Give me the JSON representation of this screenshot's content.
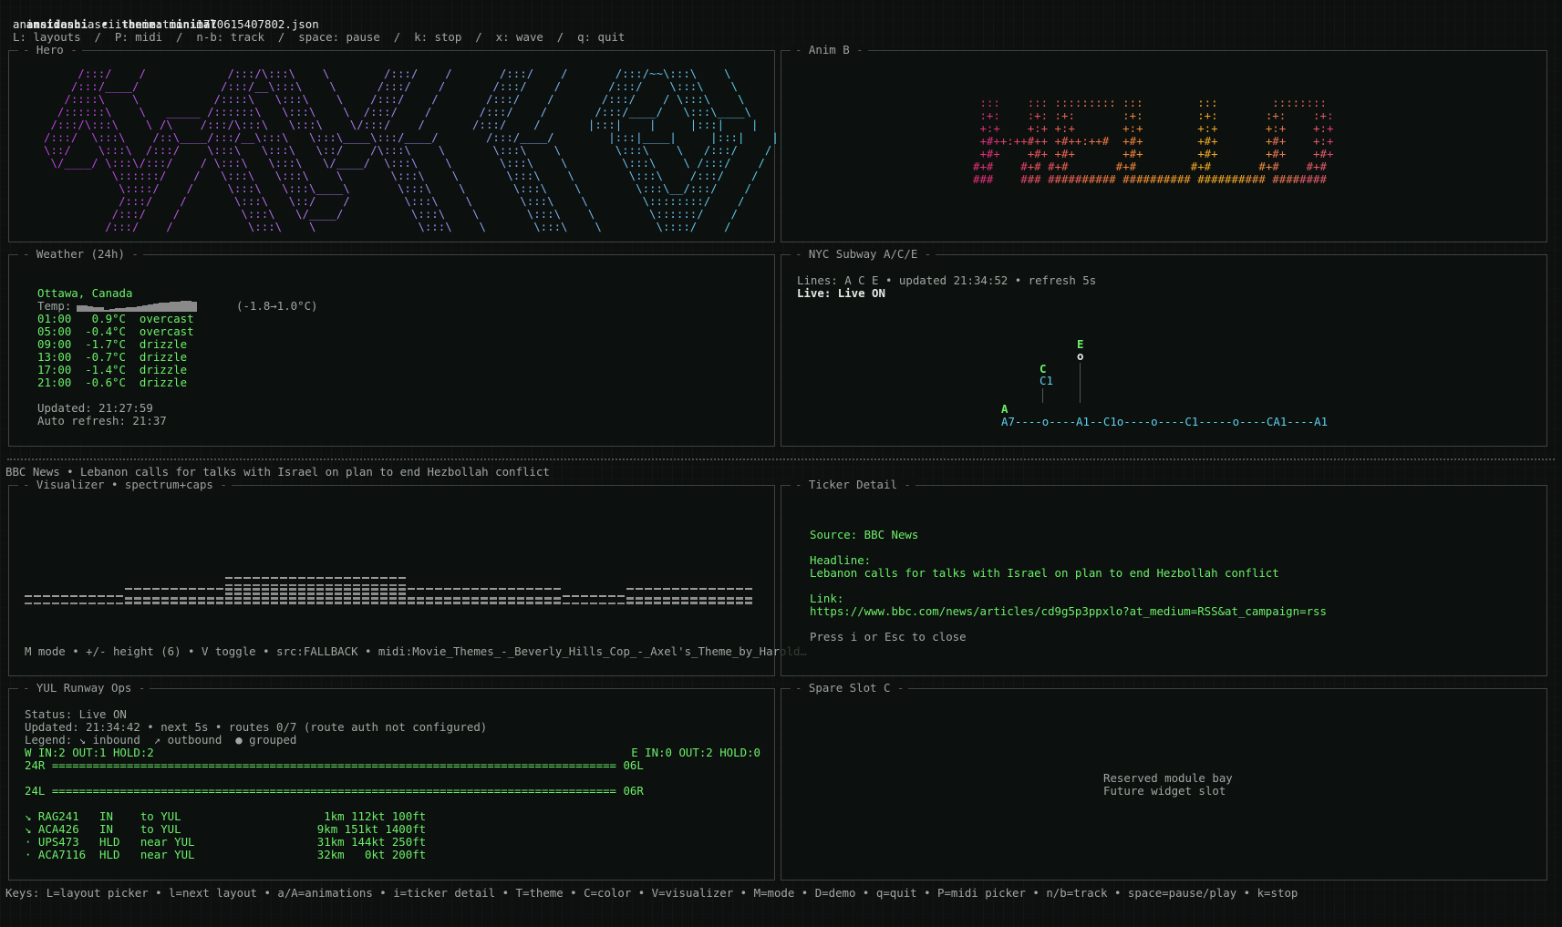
{
  "header": {
    "app_name": "ansidashi",
    "separator": "•",
    "theme_label": "theme: minimal",
    "animation_line": "animation: ascii-animation-1770615407802.json",
    "shortcuts_line": "L: layouts  /  P: midi  /  n-b: track  /  space: pause  /  k: stop  /  x: wave  /  q: quit"
  },
  "hero": {
    "title": "Hero",
    "art": "     /:::/    /            /:::/\\:::\\    \\        /:::/    /       /:::/    /       /:::/~~\\:::\\    \\\n    /:::/____/            /:::/__\\:::\\    \\      /:::/    /       /:::/    /       /:::/    \\:::\\    \\\n   /::::\\    \\           /::::\\   \\:::\\    \\    /:::/    /       /:::/    /       /:::/    / \\:::\\    \\\n  /::::::\\    \\   _____ /::::::\\   \\:::\\    \\  /:::/    /       /:::/    /       /:::/____/   \\:::\\____\\\n /:::/\\:::\\    \\ /\\    /:::/\\:::\\   \\:::\\    \\/:::/    /       /:::/    /       |:::|    |     |:::|    |\n/:::/  \\:::\\    /::\\____/:::/__\\:::\\   \\:::\\____\\:::/____/       /:::/____/        |:::|____|     |:::|    |\n\\::/    \\:::\\  /:::/    \\:::\\   \\:::\\   \\::/    /\\:::\\    \\       \\:::\\    \\        \\:::\\    \\   /:::/    /\n \\/____/ \\:::\\/:::/    / \\:::\\   \\:::\\   \\/____/  \\:::\\    \\       \\:::\\    \\        \\:::\\    \\ /:::/    /\n          \\::::::/    /   \\:::\\   \\:::\\    \\       \\:::\\    \\       \\:::\\    \\        \\:::\\    /:::/    /\n           \\::::/    /     \\:::\\   \\:::\\____\\       \\:::\\    \\       \\:::\\    \\        \\:::\\__/:::/    /\n           /:::/    /       \\:::\\   \\::/    /        \\:::\\    \\       \\:::\\    \\        \\::::::::/    /\n          /:::/    /         \\:::\\   \\/____/          \\:::\\    \\       \\:::\\    \\        \\::::::/    /\n         /:::/    /           \\:::\\    \\               \\:::\\    \\       \\:::\\    \\        \\::::/    /"
  },
  "anim_b": {
    "title": "Anim B",
    "art": " :::    ::: ::::::::: :::        :::        ::::::::\n :+:    :+: :+:       :+:        :+:       :+:    :+:\n +:+    +:+ +:+       +:+        +:+       +:+    +:+\n +#++:++#++ +#++:++#  +#+        +#+       +#+    +:+\n +#+    +#+ +#+       +#+        +#+       +#+    +#+\n#+#    #+# #+#       #+#        #+#       #+#    #+#\n###    ### ########## ########## ########## ########"
  },
  "weather": {
    "title": "Weather (24h)",
    "location": "Ottawa, Canada",
    "temp_label": "Temp:",
    "temp_range": "(-1.8→1.0°C)",
    "sparkline": [
      0.55,
      0.6,
      0.5,
      0.45,
      0.4,
      0.2,
      0.25,
      0.3,
      0.35,
      0.4,
      0.45,
      0.5,
      0.6,
      0.7,
      0.75,
      0.8,
      0.85,
      0.9,
      0.95,
      1.0,
      1.0,
      0.95
    ],
    "rows": [
      {
        "time": "01:00",
        "temp": "0.9°C",
        "cond": "overcast"
      },
      {
        "time": "05:00",
        "temp": "-0.4°C",
        "cond": "overcast"
      },
      {
        "time": "09:00",
        "temp": "-1.7°C",
        "cond": "drizzle"
      },
      {
        "time": "13:00",
        "temp": "-0.7°C",
        "cond": "drizzle"
      },
      {
        "time": "17:00",
        "temp": "-1.4°C",
        "cond": "drizzle"
      },
      {
        "time": "21:00",
        "temp": "-0.6°C",
        "cond": "drizzle"
      }
    ],
    "updated": "Updated: 21:27:59",
    "auto_refresh": "Auto refresh: 21:37"
  },
  "subway": {
    "title": "NYC Subway A/C/E",
    "status_line": "Lines: A C E • updated 21:34:52 • refresh 5s",
    "live_line": "Live: Live ON",
    "label_E": "E",
    "label_E_node": "o",
    "label_C": "C",
    "label_C1": "C1",
    "label_A": "A",
    "track": "A7----o----A1--C1o----o----C1-----o----CA1----A1"
  },
  "news_bar": "BBC News • Lebanon calls for talks with Israel on plan to end Hezbollah conflict",
  "visualizer": {
    "title": "Visualizer • spectrum+caps",
    "levels": [
      0.05,
      0.05,
      0.05,
      0.05,
      0.05,
      0.05,
      0.05,
      0.05,
      0.05,
      0.05,
      0.05,
      0.25,
      0.25,
      0.25,
      0.25,
      0.25,
      0.25,
      0.25,
      0.25,
      0.25,
      0.25,
      0.25,
      0.55,
      0.55,
      0.55,
      0.55,
      0.55,
      0.55,
      0.55,
      0.55,
      0.55,
      0.55,
      0.55,
      0.55,
      0.55,
      0.55,
      0.55,
      0.55,
      0.55,
      0.55,
      0.55,
      0.55,
      0.25,
      0.25,
      0.25,
      0.25,
      0.25,
      0.25,
      0.25,
      0.25,
      0.25,
      0.25,
      0.25,
      0.25,
      0.25,
      0.25,
      0.25,
      0.25,
      0.25,
      0.05,
      0.05,
      0.05,
      0.05,
      0.05,
      0.05,
      0.05,
      0.25,
      0.25,
      0.25,
      0.25,
      0.25,
      0.25,
      0.25,
      0.25,
      0.25,
      0.25,
      0.25,
      0.25,
      0.25,
      0.25
    ],
    "caps": [
      0.05,
      0.05,
      0.05,
      0.05,
      0.05,
      0.05,
      0.05,
      0.05,
      0.05,
      0.05,
      0.05,
      0.25,
      0.25,
      0.25,
      0.25,
      0.25,
      0.25,
      0.25,
      0.25,
      0.25,
      0.25,
      0.25,
      0.55,
      0.55,
      0.55,
      0.55,
      0.55,
      0.55,
      0.55,
      0.55,
      0.55,
      0.55,
      0.55,
      0.55,
      0.55,
      0.55,
      0.55,
      0.55,
      0.55,
      0.55,
      0.55,
      0.55,
      0.25,
      0.25,
      0.25,
      0.25,
      0.25,
      0.25,
      0.25,
      0.25,
      0.25,
      0.25,
      0.25,
      0.25,
      0.25,
      0.25,
      0.25,
      0.25,
      0.25,
      0.05,
      0.05,
      0.05,
      0.05,
      0.05,
      0.05,
      0.05,
      0.25,
      0.25,
      0.25,
      0.25,
      0.25,
      0.25,
      0.25,
      0.25,
      0.25,
      0.25,
      0.25,
      0.25,
      0.25,
      0.25
    ],
    "footer": "M mode • +/- height (6) • V toggle • src:FALLBACK • midi:Movie_Themes_-_Beverly_Hills_Cop_-_Axel's_Theme_by_Harold…"
  },
  "ticker": {
    "title": "Ticker Detail",
    "source": "Source: BBC News",
    "headline_label": "Headline:",
    "headline": "Lebanon calls for talks with Israel on plan to end Hezbollah conflict",
    "link_label": "Link:",
    "link": "https://www.bbc.com/news/articles/cd9g5p3ppxlo?at_medium=RSS&at_campaign=rss",
    "close_hint": "Press i or Esc to close"
  },
  "runway": {
    "title": "YUL Runway Ops",
    "status": "Status: Live ON",
    "updated": "Updated: 21:34:42 • next 5s • routes 0/7 (route auth not configured)",
    "legend": "Legend: ↘ inbound  ↗ outbound  ● grouped",
    "west": "W IN:2 OUT:1 HOLD:2",
    "east": "E IN:0 OUT:2 HOLD:0",
    "runway_24r": "24R =================================================================================== 06L",
    "runway_24l": "24L =================================================================================== 06R",
    "flights": [
      {
        "icon": "↘",
        "call": "RAG241",
        "state": "IN",
        "dir": "to YUL",
        "stats": "1km 112kt 100ft"
      },
      {
        "icon": "↘",
        "call": "ACA426",
        "state": "IN",
        "dir": "to YUL",
        "stats": "9km 151kt 1400ft"
      },
      {
        "icon": "·",
        "call": "UPS473",
        "state": "HLD",
        "dir": "near YUL",
        "stats": "31km 144kt 250ft"
      },
      {
        "icon": "·",
        "call": "ACA7116",
        "state": "HLD",
        "dir": "near YUL",
        "stats": "32km   0kt 200ft"
      }
    ]
  },
  "spare": {
    "title": "Spare Slot C",
    "line1": "Reserved module bay",
    "line2": "Future widget slot"
  },
  "footer_keys": "Keys: L=layout picker • l=next layout • a/A=animations • i=ticker detail • T=theme • C=color • V=visualizer • M=mode • D=demo • q=quit • P=midi picker • n/b=track • space=pause/play • k=stop",
  "colors": {
    "accent_green": "#6cf06a",
    "subway_cyan": "#5fd0f0",
    "hero_gradient": [
      "#c040e0",
      "#b070f0",
      "#7fb0f0",
      "#50d0e8"
    ],
    "animb_gradient": [
      "#e0307a",
      "#f07a40",
      "#f0b020",
      "#e04080"
    ]
  }
}
